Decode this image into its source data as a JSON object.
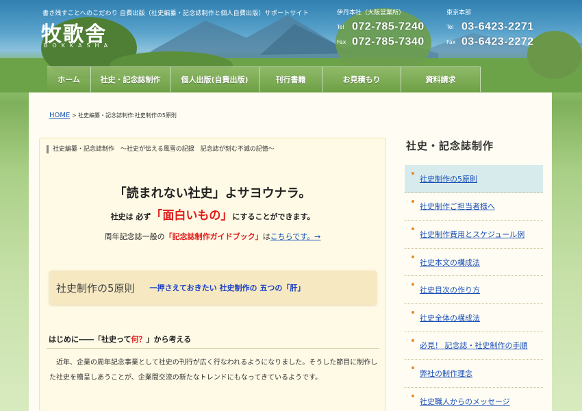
{
  "header": {
    "tagline": "書き残すことへのこだわり 自費出版（社史編纂・記念誌制作と個人自費出版）サポートサイト",
    "logo": "牧歌舎",
    "logo_sub": "BOKKASHA",
    "offices": [
      {
        "name": "伊丹本社（大阪営業所）",
        "tel_label": "Tel",
        "tel": "072-785-7240",
        "fax_label": "Fax",
        "fax": "072-785-7340"
      },
      {
        "name": "東京本部",
        "tel_label": "Tel",
        "tel": "03-6423-2271",
        "fax_label": "Fax",
        "fax": "03-6423-2272"
      }
    ]
  },
  "nav": [
    {
      "label": "ホーム"
    },
    {
      "label": "社史・記念誌制作"
    },
    {
      "label": "個人出版(自費出版)"
    },
    {
      "label": "刊行書籍"
    },
    {
      "label": "お見積もり"
    },
    {
      "label": "資料請求"
    }
  ],
  "breadcrumb": {
    "home": "HOME",
    "rest": " > 社史編纂・記念誌制作:社史制作の5原則"
  },
  "content": {
    "head": "社史編纂・記念誌制作　～社史が伝える風雪の記録　記念誌が刻む不滅の記憶～",
    "lead1": "「読まれない社史」よサヨウナラ。",
    "lead2_a": "社史は 必ず",
    "lead2_b": "「面白いもの」",
    "lead2_c": "にすることができます。",
    "lead3_a": "周年記念誌一般の",
    "lead3_b": "「記念誌制作ガイドブック」",
    "lead3_c": "は",
    "lead3_link": "こちらです。→",
    "principle_title": "社史制作の5原則",
    "principle_sub": "一押さえておきたい 社史制作の 五つの「肝」",
    "section_title_a": "はじめに――「社史って",
    "section_title_b": "何？",
    "section_title_c": "」から考える",
    "body": "近年、企業の周年記念事業として社史の刊行が広く行なわれるようになりました。そうした節目に制作した社史を贈呈しあうことが、企業間交流の新たなトレンドにもなってきているようです。"
  },
  "sidebar": {
    "title": "社史・記念誌制作",
    "items": [
      {
        "label": "社史制作の5原則",
        "active": true
      },
      {
        "label": "社史制作ご担当者様へ"
      },
      {
        "label": "社史制作費用とスケジュール例"
      },
      {
        "label": "社史本文の構成法"
      },
      {
        "label": "社史目次の作り方"
      },
      {
        "label": "社史全体の構成法"
      },
      {
        "label": "必見！ 記念誌・社史制作の手順"
      },
      {
        "label": "弊社の制作理念"
      },
      {
        "label": "社史職人からのメッセージ"
      }
    ]
  }
}
